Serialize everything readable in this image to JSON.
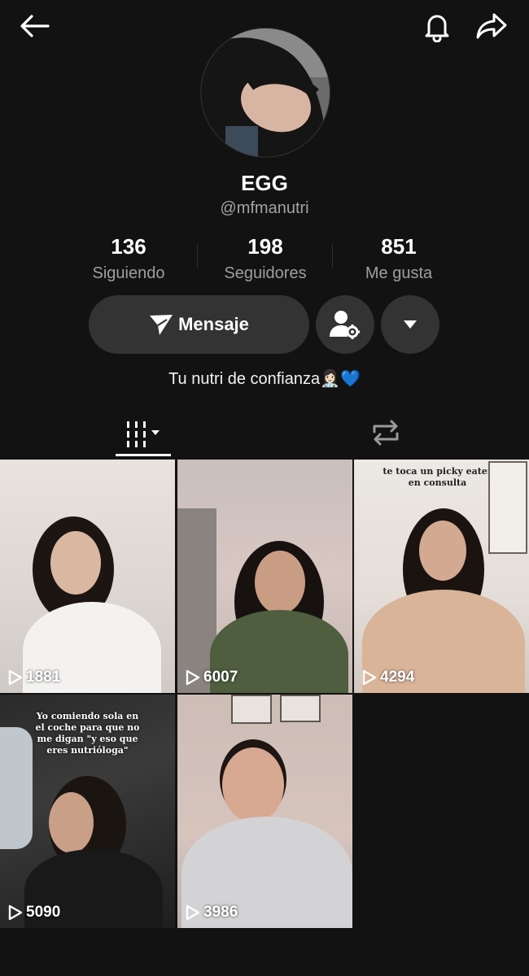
{
  "header": {
    "back_icon": "arrow-left-icon",
    "notification_icon": "bell-icon",
    "share_icon": "share-arrow-icon"
  },
  "profile": {
    "name": "EGG",
    "handle": "@mfmanutri",
    "bio": "Tu nutri de confianza👩🏻‍⚕️💙"
  },
  "stats": [
    {
      "value": "136",
      "label": "Siguiendo"
    },
    {
      "value": "198",
      "label": "Seguidores"
    },
    {
      "value": "851",
      "label": "Me gusta"
    }
  ],
  "actions": {
    "message_label": "Mensaje",
    "message_icon": "send-icon",
    "follow_options_icon": "person-gear-icon",
    "more_icon": "caret-down-icon"
  },
  "tabs": {
    "videos_icon": "grid-icon",
    "reposts_icon": "repost-icon"
  },
  "videos": [
    {
      "views": "1881",
      "caption": ""
    },
    {
      "views": "6007",
      "caption": ""
    },
    {
      "views": "4294",
      "caption": "te toca un picky eater en consulta"
    },
    {
      "views": "5090",
      "caption": "Yo comiendo sola en el coche para que no me digan \"y eso que eres nutrióloga\""
    },
    {
      "views": "3986",
      "caption": ""
    }
  ],
  "colors": {
    "background": "#121212",
    "button": "#333333",
    "secondary_text": "#a3a3a3",
    "heart": "#5bb8f0"
  }
}
